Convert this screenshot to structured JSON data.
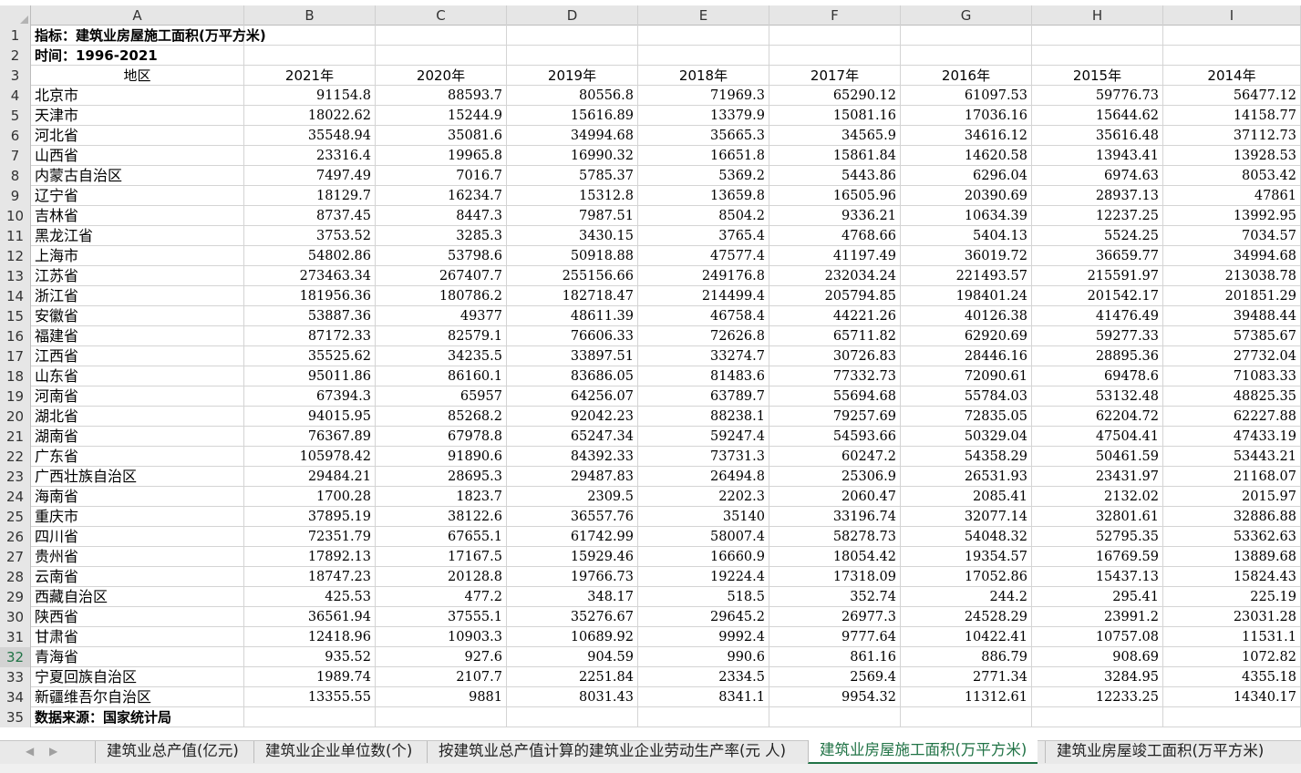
{
  "columns": [
    "A",
    "B",
    "C",
    "D",
    "E",
    "F",
    "G",
    "H",
    "I"
  ],
  "row1": "指标：建筑业房屋施工面积(万平方米)",
  "row2": "时间：1996-2021",
  "header": {
    "region": "地区",
    "years": [
      "2021年",
      "2020年",
      "2019年",
      "2018年",
      "2017年",
      "2016年",
      "2015年",
      "2014年"
    ]
  },
  "rows": [
    [
      "北京市",
      "91154.8",
      "88593.7",
      "80556.8",
      "71969.3",
      "65290.12",
      "61097.53",
      "59776.73",
      "56477.12"
    ],
    [
      "天津市",
      "18022.62",
      "15244.9",
      "15616.89",
      "13379.9",
      "15081.16",
      "17036.16",
      "15644.62",
      "14158.77"
    ],
    [
      "河北省",
      "35548.94",
      "35081.6",
      "34994.68",
      "35665.3",
      "34565.9",
      "34616.12",
      "35616.48",
      "37112.73"
    ],
    [
      "山西省",
      "23316.4",
      "19965.8",
      "16990.32",
      "16651.8",
      "15861.84",
      "14620.58",
      "13943.41",
      "13928.53"
    ],
    [
      "内蒙古自治区",
      "7497.49",
      "7016.7",
      "5785.37",
      "5369.2",
      "5443.86",
      "6296.04",
      "6974.63",
      "8053.42"
    ],
    [
      "辽宁省",
      "18129.7",
      "16234.7",
      "15312.8",
      "13659.8",
      "16505.96",
      "20390.69",
      "28937.13",
      "47861"
    ],
    [
      "吉林省",
      "8737.45",
      "8447.3",
      "7987.51",
      "8504.2",
      "9336.21",
      "10634.39",
      "12237.25",
      "13992.95"
    ],
    [
      "黑龙江省",
      "3753.52",
      "3285.3",
      "3430.15",
      "3765.4",
      "4768.66",
      "5404.13",
      "5524.25",
      "7034.57"
    ],
    [
      "上海市",
      "54802.86",
      "53798.6",
      "50918.88",
      "47577.4",
      "41197.49",
      "36019.72",
      "36659.77",
      "34994.68"
    ],
    [
      "江苏省",
      "273463.34",
      "267407.7",
      "255156.66",
      "249176.8",
      "232034.24",
      "221493.57",
      "215591.97",
      "213038.78"
    ],
    [
      "浙江省",
      "181956.36",
      "180786.2",
      "182718.47",
      "214499.4",
      "205794.85",
      "198401.24",
      "201542.17",
      "201851.29"
    ],
    [
      "安徽省",
      "53887.36",
      "49377",
      "48611.39",
      "46758.4",
      "44221.26",
      "40126.38",
      "41476.49",
      "39488.44"
    ],
    [
      "福建省",
      "87172.33",
      "82579.1",
      "76606.33",
      "72626.8",
      "65711.82",
      "62920.69",
      "59277.33",
      "57385.67"
    ],
    [
      "江西省",
      "35525.62",
      "34235.5",
      "33897.51",
      "33274.7",
      "30726.83",
      "28446.16",
      "28895.36",
      "27732.04"
    ],
    [
      "山东省",
      "95011.86",
      "86160.1",
      "83686.05",
      "81483.6",
      "77332.73",
      "72090.61",
      "69478.6",
      "71083.33"
    ],
    [
      "河南省",
      "67394.3",
      "65957",
      "64256.07",
      "63789.7",
      "55694.68",
      "55784.03",
      "53132.48",
      "48825.35"
    ],
    [
      "湖北省",
      "94015.95",
      "85268.2",
      "92042.23",
      "88238.1",
      "79257.69",
      "72835.05",
      "62204.72",
      "62227.88"
    ],
    [
      "湖南省",
      "76367.89",
      "67978.8",
      "65247.34",
      "59247.4",
      "54593.66",
      "50329.04",
      "47504.41",
      "47433.19"
    ],
    [
      "广东省",
      "105978.42",
      "91890.6",
      "84392.33",
      "73731.3",
      "60247.2",
      "54358.29",
      "50461.59",
      "53443.21"
    ],
    [
      "广西壮族自治区",
      "29484.21",
      "28695.3",
      "29487.83",
      "26494.8",
      "25306.9",
      "26531.93",
      "23431.97",
      "21168.07"
    ],
    [
      "海南省",
      "1700.28",
      "1823.7",
      "2309.5",
      "2202.3",
      "2060.47",
      "2085.41",
      "2132.02",
      "2015.97"
    ],
    [
      "重庆市",
      "37895.19",
      "38122.6",
      "36557.76",
      "35140",
      "33196.74",
      "32077.14",
      "32801.61",
      "32886.88"
    ],
    [
      "四川省",
      "72351.79",
      "67655.1",
      "61742.99",
      "58007.4",
      "58278.73",
      "54048.32",
      "52795.35",
      "53362.63"
    ],
    [
      "贵州省",
      "17892.13",
      "17167.5",
      "15929.46",
      "16660.9",
      "18054.42",
      "19354.57",
      "16769.59",
      "13889.68"
    ],
    [
      "云南省",
      "18747.23",
      "20128.8",
      "19766.73",
      "19224.4",
      "17318.09",
      "17052.86",
      "15437.13",
      "15824.43"
    ],
    [
      "西藏自治区",
      "425.53",
      "477.2",
      "348.17",
      "518.5",
      "352.74",
      "244.2",
      "295.41",
      "225.19"
    ],
    [
      "陕西省",
      "36561.94",
      "37555.1",
      "35276.67",
      "29645.2",
      "26977.3",
      "24528.29",
      "23991.2",
      "23031.28"
    ],
    [
      "甘肃省",
      "12418.96",
      "10903.3",
      "10689.92",
      "9992.4",
      "9777.64",
      "10422.41",
      "10757.08",
      "11531.1"
    ],
    [
      "青海省",
      "935.52",
      "927.6",
      "904.59",
      "990.6",
      "861.16",
      "886.79",
      "908.69",
      "1072.82"
    ],
    [
      "宁夏回族自治区",
      "1989.74",
      "2107.7",
      "2251.84",
      "2334.5",
      "2569.4",
      "2771.34",
      "3284.95",
      "4355.18"
    ],
    [
      "新疆维吾尔自治区",
      "13355.55",
      "9881",
      "8031.43",
      "8341.1",
      "9954.32",
      "11312.61",
      "12233.25",
      "14340.17"
    ]
  ],
  "footer": "数据来源：国家统计局",
  "selected_row": 32,
  "tabs": [
    {
      "label": "建筑业总产值(亿元)",
      "active": false
    },
    {
      "label": "建筑业企业单位数(个)",
      "active": false
    },
    {
      "label": "按建筑业总产值计算的建筑业企业劳动生产率(元 人)",
      "active": false
    },
    {
      "label": "建筑业房屋施工面积(万平方米)",
      "active": true
    },
    {
      "label": "建筑业房屋竣工面积(万平方米)",
      "active": false
    }
  ],
  "colors": {
    "accent": "#217346",
    "header_bg": "#e6e6e6",
    "grid": "#d4d4d4"
  }
}
